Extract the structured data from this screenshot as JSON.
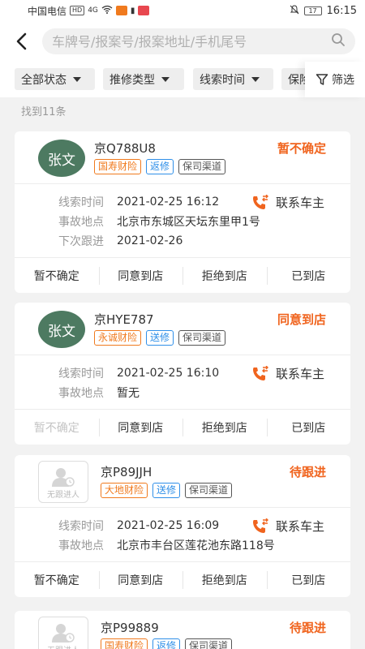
{
  "statusbar": {
    "carrier": "中国电信",
    "hd": "HD",
    "signal": "4G",
    "battery": "17",
    "time": "16:15"
  },
  "search": {
    "placeholder": "车牌号/报案号/报案地址/手机尾号",
    "icon": "search-icon"
  },
  "filters": {
    "items": [
      {
        "label": "全部状态"
      },
      {
        "label": "推修类型"
      },
      {
        "label": "线索时间"
      },
      {
        "label": "保险公司"
      }
    ],
    "screen_label": "筛选"
  },
  "result_count": "找到11条",
  "labels": {
    "clue_time": "线索时间",
    "accident_place": "事故地点",
    "next_follow": "下次跟进",
    "contact": "联系车主",
    "no_follower": "无跟进人"
  },
  "cards": [
    {
      "avatar": "张文",
      "plate": "京Q788U8",
      "status": "暂不确定",
      "tags": [
        "国寿财险",
        "返修",
        "保司渠道"
      ],
      "clue_time": "2021-02-25 16:12",
      "accident_place": "北京市东城区天坛东里甲1号",
      "next_follow": "2021-02-26",
      "actions": [
        "暂不确定",
        "同意到店",
        "拒绝到店",
        "已到店"
      ]
    },
    {
      "avatar": "张文",
      "plate": "京HYE787",
      "status": "同意到店",
      "tags": [
        "永诚财险",
        "送修",
        "保司渠道"
      ],
      "clue_time": "2021-02-25 16:10",
      "accident_place": "暂无",
      "actions": [
        "暂不确定",
        "同意到店",
        "拒绝到店",
        "已到店"
      ]
    },
    {
      "avatar": "",
      "plate": "京P89JJH",
      "status": "待跟进",
      "tags": [
        "大地财险",
        "送修",
        "保司渠道"
      ],
      "clue_time": "2021-02-25 16:09",
      "accident_place": "北京市丰台区莲花池东路118号",
      "actions": [
        "暂不确定",
        "同意到店",
        "拒绝到店",
        "已到店"
      ]
    },
    {
      "avatar": "",
      "plate": "京P99889",
      "status": "待跟进",
      "tags": [
        "国寿财险",
        "返修",
        "保司渠道"
      ]
    }
  ],
  "colors": {
    "accent_orange": "#f0641e",
    "avatar_green": "#4d7a61",
    "tag_blue": "#2f8fe8"
  }
}
